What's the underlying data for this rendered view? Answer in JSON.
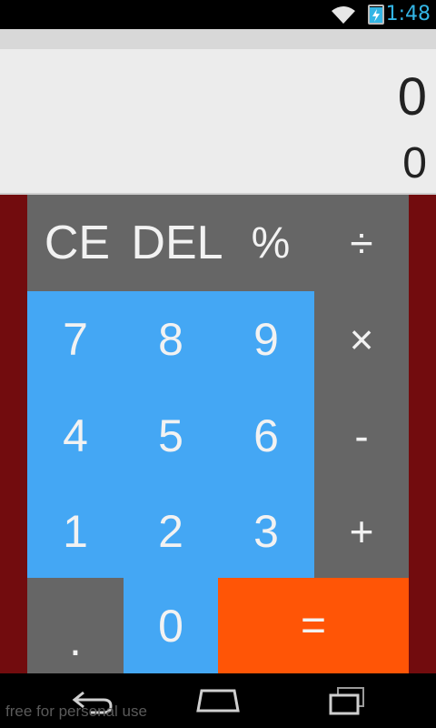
{
  "status_bar": {
    "time": "1:48",
    "icons": [
      "wifi-icon",
      "battery-charging-icon"
    ],
    "time_color": "#33b5e5"
  },
  "display": {
    "expression": "0",
    "result": "0"
  },
  "keypad": {
    "ce": "CE",
    "del": "DEL",
    "percent": "%",
    "divide": "÷",
    "multiply": "×",
    "minus": "-",
    "plus": "+",
    "equals": "=",
    "decimal": ".",
    "digits": {
      "d0": "0",
      "d1": "1",
      "d2": "2",
      "d3": "3",
      "d4": "4",
      "d5": "5",
      "d6": "6",
      "d7": "7",
      "d8": "8",
      "d9": "9"
    }
  },
  "colors": {
    "gray": "#666666",
    "blue": "#44a7f4",
    "orange": "#ff5506",
    "side": "#720c0e"
  },
  "nav_bar": {
    "buttons": [
      "back-icon",
      "home-icon",
      "recent-apps-icon"
    ]
  },
  "watermark": "free for personal use"
}
